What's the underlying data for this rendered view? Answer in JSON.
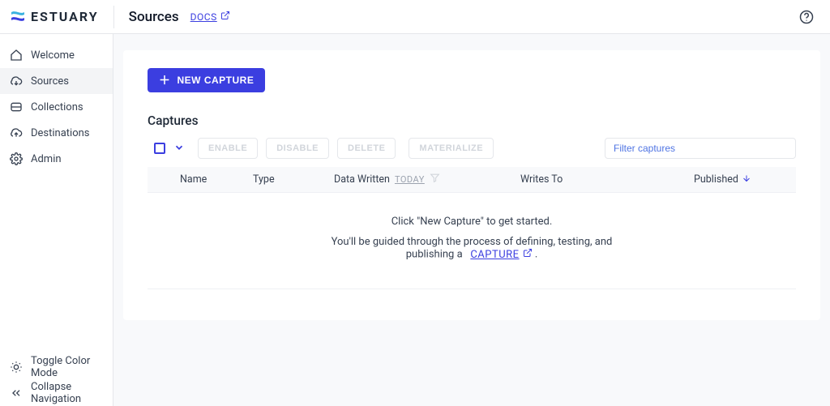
{
  "brand": "ESTUARY",
  "header": {
    "title": "Sources",
    "docs_label": "DOCS"
  },
  "sidebar": {
    "items": [
      {
        "label": "Welcome"
      },
      {
        "label": "Sources"
      },
      {
        "label": "Collections"
      },
      {
        "label": "Destinations"
      },
      {
        "label": "Admin"
      }
    ],
    "bottom": [
      {
        "label": "Toggle Color Mode"
      },
      {
        "label": "Collapse Navigation"
      }
    ],
    "active_index": 1
  },
  "main": {
    "new_capture_label": "NEW CAPTURE",
    "section_title": "Captures",
    "toolbar": {
      "enable": "ENABLE",
      "disable": "DISABLE",
      "delete": "DELETE",
      "materialize": "MATERIALIZE",
      "filter_placeholder": "Filter captures"
    },
    "columns": {
      "name": "Name",
      "type": "Type",
      "data_written": "Data Written",
      "data_range": "TODAY",
      "writes_to": "Writes To",
      "published": "Published"
    },
    "empty": {
      "line1": "Click \"New Capture\" to get started.",
      "line2a": "You'll be guided through the process of defining, testing, and",
      "line2b": "publishing a",
      "capture_link": "CAPTURE",
      "period": "."
    }
  }
}
